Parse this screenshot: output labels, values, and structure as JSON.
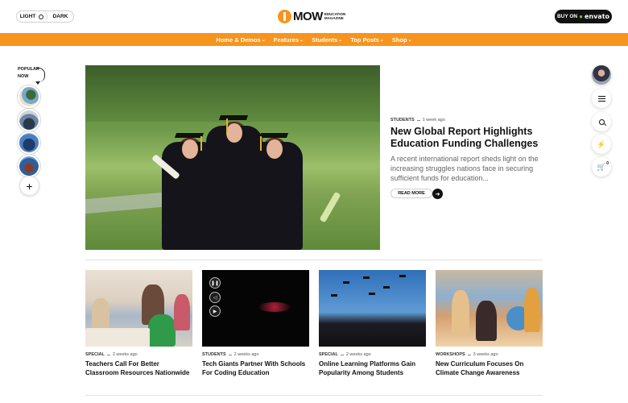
{
  "header": {
    "theme_light": "LIGHT",
    "theme_dark": "DARK",
    "logo_main": "MOW",
    "logo_sub_1": "EDUCATION",
    "logo_sub_2": "MAGAZINE",
    "buy_prefix": "BUY ON",
    "buy_brand": "envato"
  },
  "nav": {
    "items": [
      "Home & Demos",
      "Features",
      "Students",
      "Top Posts",
      "Shop"
    ]
  },
  "left_rail": {
    "popular_line1": "POPULAR",
    "popular_line2": "NOW"
  },
  "right_rail": {
    "cart_count": "0"
  },
  "hero": {
    "category": "STUDENTS",
    "date": "1 week ago",
    "title": "New Global Report Highlights Education Funding Challenges",
    "excerpt": "A recent international report sheds light on the increasing struggles nations face in securing sufficient funds for education...",
    "read_more": "READ MORE"
  },
  "cards": [
    {
      "category": "SPECIAL",
      "date": "2 weeks ago",
      "title": "Teachers Call For Better Classroom Resources Nationwide"
    },
    {
      "category": "STUDENTS",
      "date": "2 weeks ago",
      "title": "Tech Giants Partner With Schools For Coding Education"
    },
    {
      "category": "SPECIAL",
      "date": "2 weeks ago",
      "title": "Online Learning Platforms Gain Popularity Among Students"
    },
    {
      "category": "WORKSHOPS",
      "date": "3 weeks ago",
      "title": "New Curriculum Focuses On Climate Change Awareness"
    }
  ],
  "colors": {
    "accent": "#f7941d",
    "dark": "#111111",
    "envato_green": "#82b541"
  },
  "icons": [
    "sun-icon",
    "chevron-down-icon",
    "plus-icon",
    "menu-icon",
    "search-icon",
    "bolt-icon",
    "cart-icon",
    "arrow-right-icon",
    "pause-icon",
    "volume-icon",
    "youtube-icon"
  ]
}
